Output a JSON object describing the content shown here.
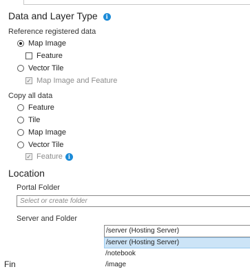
{
  "section_title": "Data and Layer Type",
  "reference": {
    "label": "Reference registered data",
    "options": [
      {
        "label": "Map Image",
        "checked": true
      },
      {
        "label": "Vector Tile",
        "checked": false
      }
    ],
    "map_image_sub": {
      "label": "Feature",
      "checked": false
    },
    "vector_tile_sub": {
      "label": "Map Image and Feature",
      "checked": true,
      "disabled": true
    }
  },
  "copy": {
    "label": "Copy all data",
    "options": [
      {
        "label": "Feature",
        "checked": false
      },
      {
        "label": "Tile",
        "checked": false
      },
      {
        "label": "Map Image",
        "checked": false
      },
      {
        "label": "Vector Tile",
        "checked": false
      }
    ],
    "vector_tile_sub": {
      "label": "Feature",
      "checked": true,
      "disabled": true
    }
  },
  "location": {
    "title": "Location",
    "portal_folder_label": "Portal Folder",
    "portal_folder_placeholder": "Select or create folder",
    "server_folder_label": "Server and Folder",
    "server_folder_value": "/server (Hosting Server)",
    "dropdown_options": [
      "/server (Hosting Server)",
      "/notebook",
      "/image"
    ],
    "selected_index": 0
  },
  "truncated_heading": "Fin",
  "colors": {
    "accent": "#1c8bd8",
    "selection": "#cce4f7"
  }
}
